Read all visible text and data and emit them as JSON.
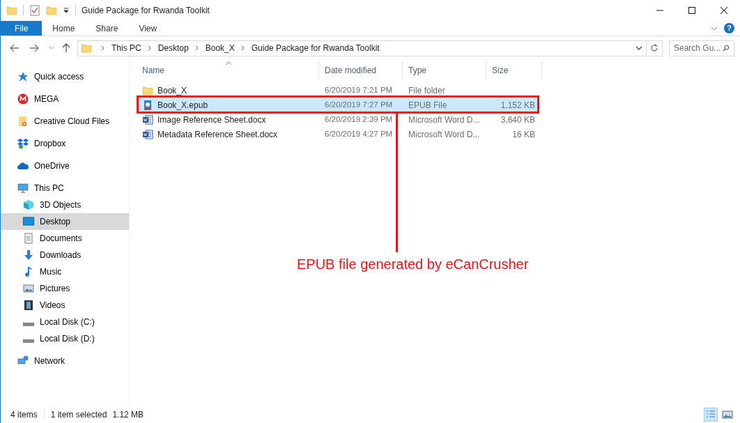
{
  "window": {
    "title": "Guide Package for Rwanda Toolkit"
  },
  "ribbon_tabs": [
    {
      "label": "File",
      "kind": "menu"
    },
    {
      "label": "Home",
      "kind": "tab"
    },
    {
      "label": "Share",
      "kind": "tab"
    },
    {
      "label": "View",
      "kind": "tab"
    }
  ],
  "help_button": {
    "label": "?"
  },
  "address_bar": {
    "path": [
      "This PC",
      "Desktop",
      "Book_X",
      "Guide Package for Rwanda Toolkit"
    ]
  },
  "search": {
    "placeholder": "Search Gu..."
  },
  "sidebar": {
    "items": [
      {
        "label": "Quick access",
        "kind": "star",
        "selected": false
      },
      {
        "label": "MEGA",
        "kind": "mega",
        "selected": false
      },
      {
        "label": "Creative Cloud Files",
        "kind": "cc",
        "selected": false
      },
      {
        "label": "Dropbox",
        "kind": "dropbox",
        "selected": false
      },
      {
        "label": "OneDrive",
        "kind": "cloud",
        "selected": false
      },
      {
        "label": "This PC",
        "kind": "pc",
        "selected": false,
        "children": [
          {
            "label": "3D Objects",
            "kind": "cube",
            "selected": false
          },
          {
            "label": "Desktop",
            "kind": "desktop",
            "selected": true
          },
          {
            "label": "Documents",
            "kind": "doc",
            "selected": false
          },
          {
            "label": "Downloads",
            "kind": "download",
            "selected": false
          },
          {
            "label": "Music",
            "kind": "music",
            "selected": false
          },
          {
            "label": "Pictures",
            "kind": "picture",
            "selected": false
          },
          {
            "label": "Videos",
            "kind": "video",
            "selected": false
          },
          {
            "label": "Local Disk (C:)",
            "kind": "disk",
            "selected": false
          },
          {
            "label": "Local Disk (D:)",
            "kind": "disk",
            "selected": false
          }
        ]
      },
      {
        "label": "Network",
        "kind": "network",
        "selected": false
      }
    ]
  },
  "table": {
    "columns": [
      "Name",
      "Date modified",
      "Type",
      "Size"
    ],
    "rows": [
      {
        "name": "Book_X",
        "date": "6/20/2019 7:21 PM",
        "type": "File folder",
        "kind": "folder",
        "selected": false
      },
      {
        "name": "Book_X.epub",
        "date": "6/20/2019 7:27 PM",
        "type": "EPUB File",
        "size": "1,152 KB",
        "kind": "epub",
        "selected": true
      },
      {
        "name": "Image Reference Sheet.docx",
        "date": "6/20/2019 2:39 PM",
        "type": "Microsoft Word D...",
        "size": "3,640 KB",
        "kind": "word",
        "selected": false
      },
      {
        "name": "Metadata Reference Sheet.docx",
        "date": "6/20/2019 4:27 PM",
        "type": "Microsoft Word D...",
        "size": "16 KB",
        "kind": "word",
        "selected": false
      }
    ]
  },
  "status_bar": {
    "item_count": "4 items",
    "selection": "1 item selected",
    "selection_size": "1.12 MB",
    "views": [
      {
        "kind": "details",
        "selected": true
      },
      {
        "kind": "large-icons",
        "selected": false
      }
    ]
  },
  "annotation": {
    "text": "EPUB file generated by eCanCrusher"
  }
}
